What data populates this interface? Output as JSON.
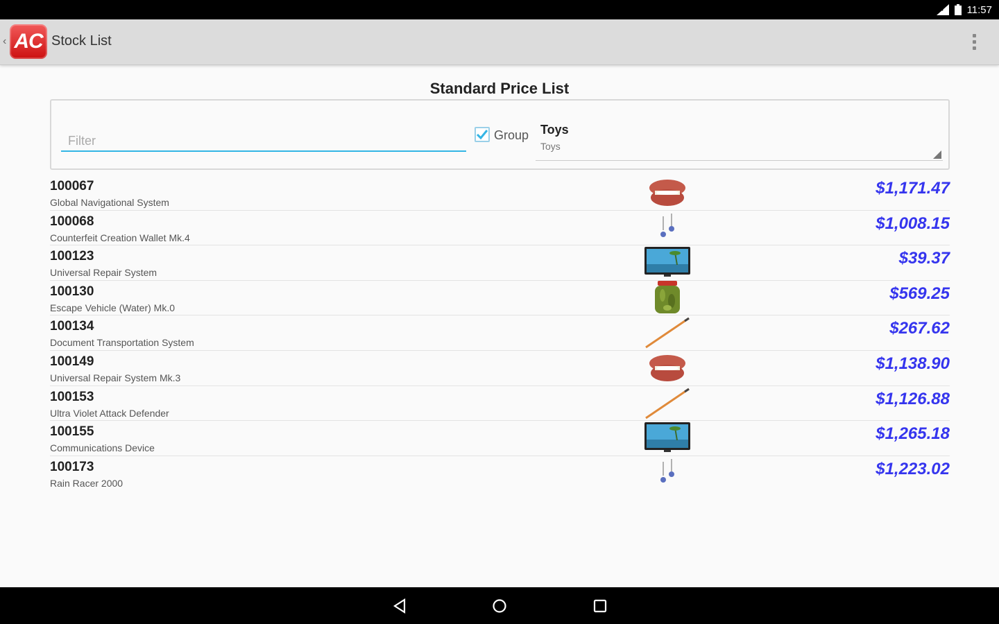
{
  "status_bar": {
    "time": "11:57"
  },
  "action_bar": {
    "logo_text": "AC",
    "title": "Stock List",
    "overflow_icon": "overflow-menu-icon"
  },
  "page": {
    "title": "Standard Price List"
  },
  "filter": {
    "placeholder": "Filter",
    "value": "",
    "group_label": "Group",
    "group_checked": true,
    "category": {
      "main": "Toys",
      "sub": "Toys"
    }
  },
  "accent_color": "#33b5e5",
  "price_color": "#3535ee",
  "items": [
    {
      "code": "100067",
      "description": "Global Navigational System",
      "image": "dentures-icon",
      "price": "$1,171.47"
    },
    {
      "code": "100068",
      "description": "Counterfeit Creation Wallet Mk.4",
      "image": "earrings-icon",
      "price": "$1,008.15"
    },
    {
      "code": "100123",
      "description": "Universal Repair System",
      "image": "tv-monitor-icon",
      "price": "$39.37"
    },
    {
      "code": "100130",
      "description": "Escape Vehicle (Water) Mk.0",
      "image": "pickle-jar-icon",
      "price": "$569.25"
    },
    {
      "code": "100134",
      "description": "Document Transportation System",
      "image": "pencil-icon",
      "price": "$267.62"
    },
    {
      "code": "100149",
      "description": "Universal Repair System Mk.3",
      "image": "dentures-icon",
      "price": "$1,138.90"
    },
    {
      "code": "100153",
      "description": "Ultra Violet Attack Defender",
      "image": "pencil-icon",
      "price": "$1,126.88"
    },
    {
      "code": "100155",
      "description": "Communications Device",
      "image": "tv-monitor-icon",
      "price": "$1,265.18"
    },
    {
      "code": "100173",
      "description": "Rain Racer 2000",
      "image": "earrings-icon",
      "price": "$1,223.02"
    }
  ],
  "nav_bar": {
    "back": "back-icon",
    "home": "home-icon",
    "recents": "recents-icon"
  }
}
